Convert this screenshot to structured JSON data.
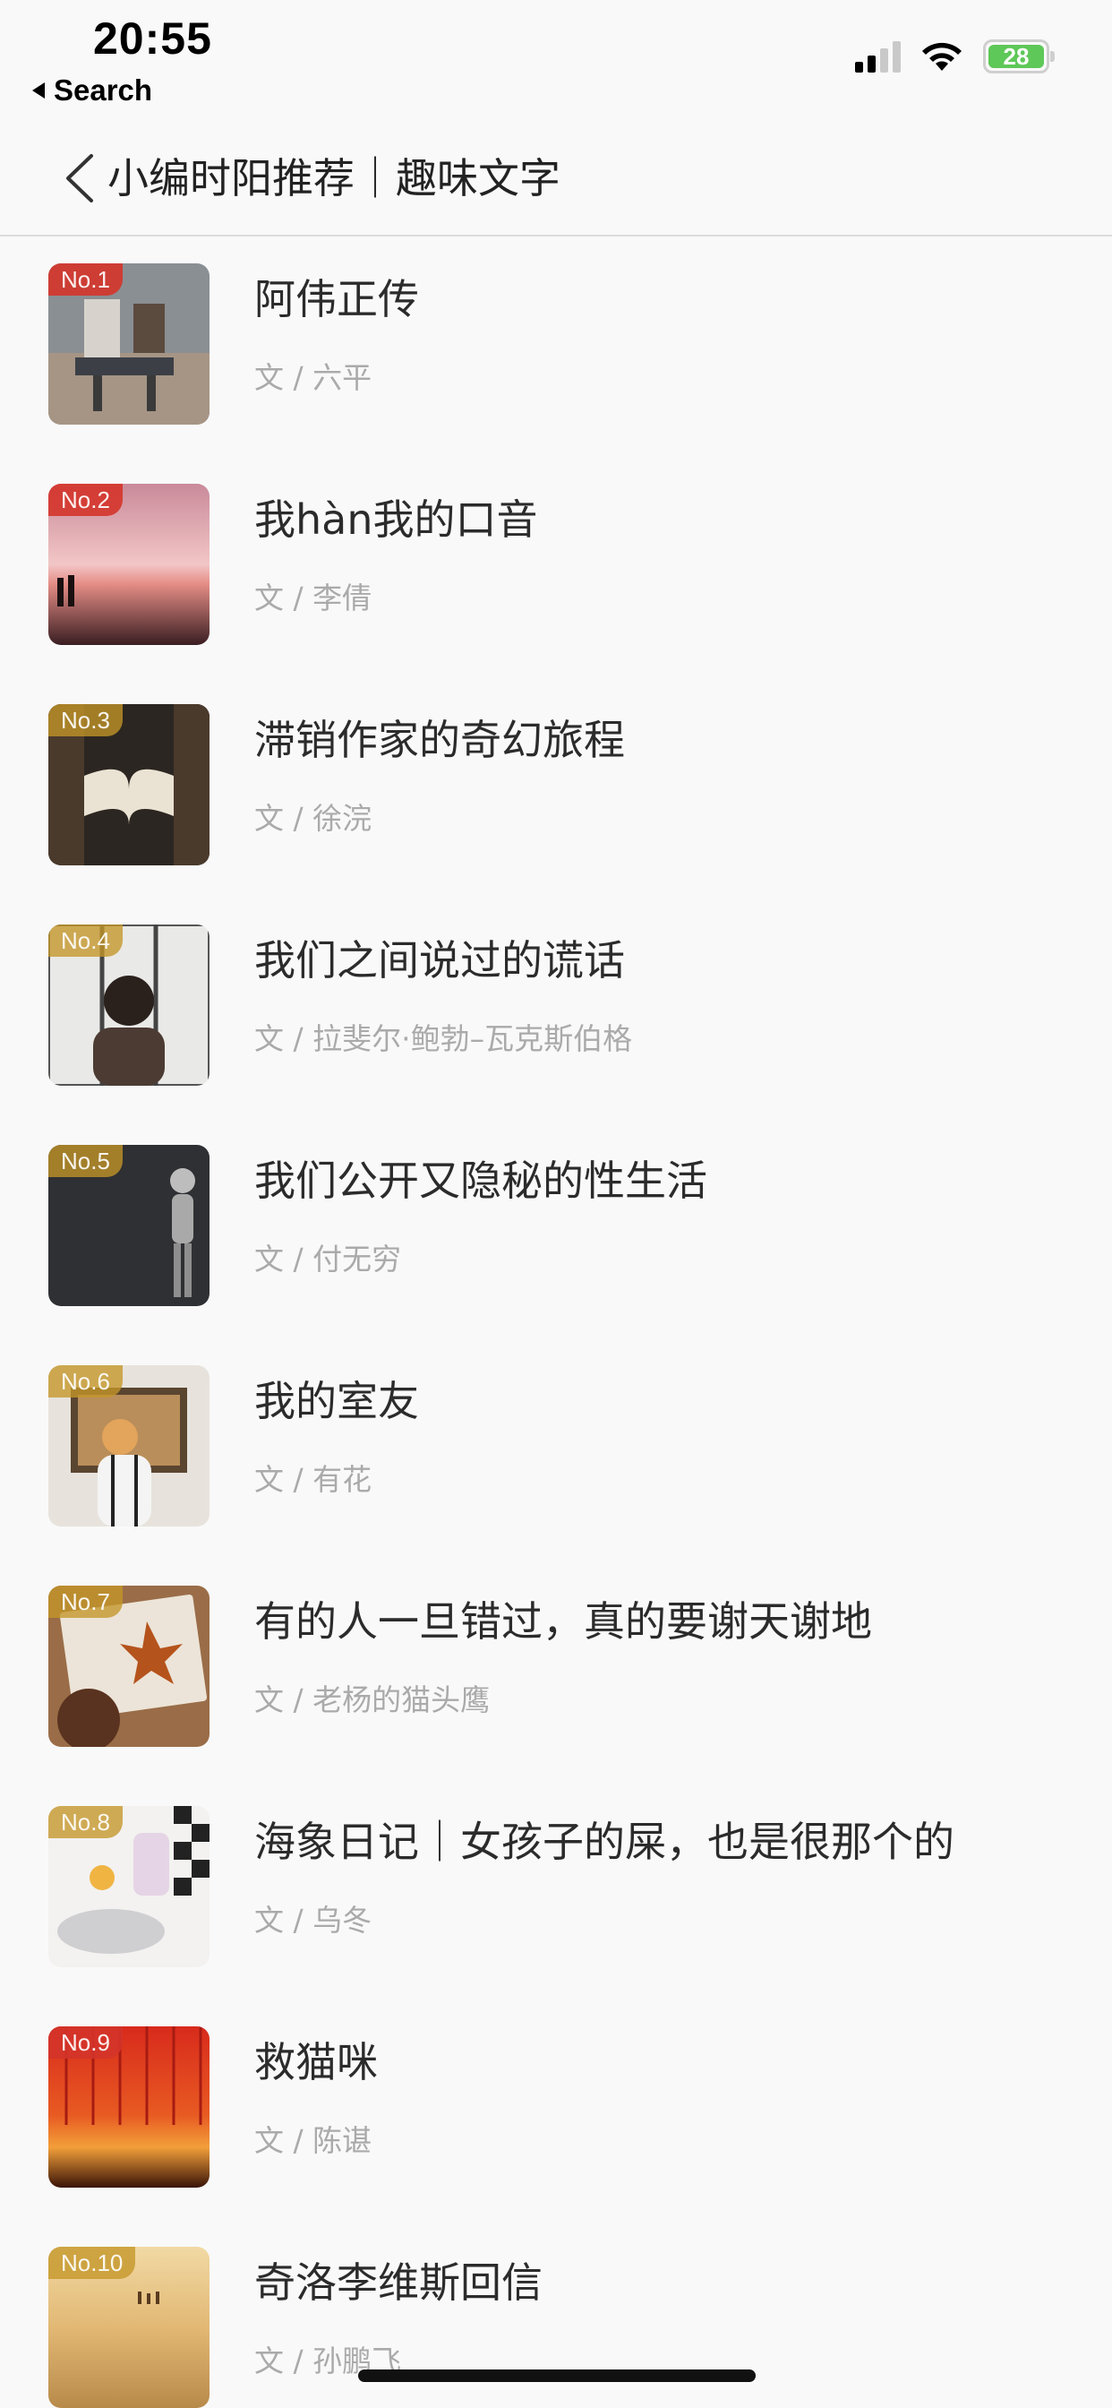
{
  "status_bar": {
    "time": "20:55",
    "back_app_label": "Search",
    "battery_percent": "28",
    "battery_level": 0.28,
    "signal_bars_active": 2,
    "signal_bars_total": 4
  },
  "header": {
    "title": "小编时阳推荐｜趣味文字",
    "back_icon": "chevron-left-icon"
  },
  "colors": {
    "rank_red": "#d4342a",
    "rank_gold": "#c49628",
    "battery_green": "#5ec858",
    "author_grey": "#aaaaaa"
  },
  "articles": [
    {
      "rank": "No.1",
      "title": "阿伟正传",
      "author": "文 / 六平",
      "badge": "red"
    },
    {
      "rank": "No.2",
      "title": "我hàn我的口音",
      "author": "文 / 李倩",
      "badge": "red"
    },
    {
      "rank": "No.3",
      "title": "滞销作家的奇幻旅程",
      "author": "文 / 徐浣",
      "badge": "gold"
    },
    {
      "rank": "No.4",
      "title": "我们之间说过的谎话",
      "author": "文 / 拉斐尔·鲍勃–瓦克斯伯格",
      "badge": "gold"
    },
    {
      "rank": "No.5",
      "title": "我们公开又隐秘的性生活",
      "author": "文 / 付无穷",
      "badge": "gold"
    },
    {
      "rank": "No.6",
      "title": "我的室友",
      "author": "文 / 有花",
      "badge": "gold"
    },
    {
      "rank": "No.7",
      "title": "有的人一旦错过，真的要谢天谢地",
      "author": "文 / 老杨的猫头鹰",
      "badge": "gold"
    },
    {
      "rank": "No.8",
      "title": "海象日记｜女孩子的屎，也是很那个的",
      "author": "文 / 乌冬",
      "badge": "gold"
    },
    {
      "rank": "No.9",
      "title": "救猫咪",
      "author": "文 / 陈谌",
      "badge": "gold"
    },
    {
      "rank": "No.10",
      "title": "奇洛李维斯回信",
      "author": "文 / 孙鹏飞",
      "badge": "gold"
    }
  ]
}
